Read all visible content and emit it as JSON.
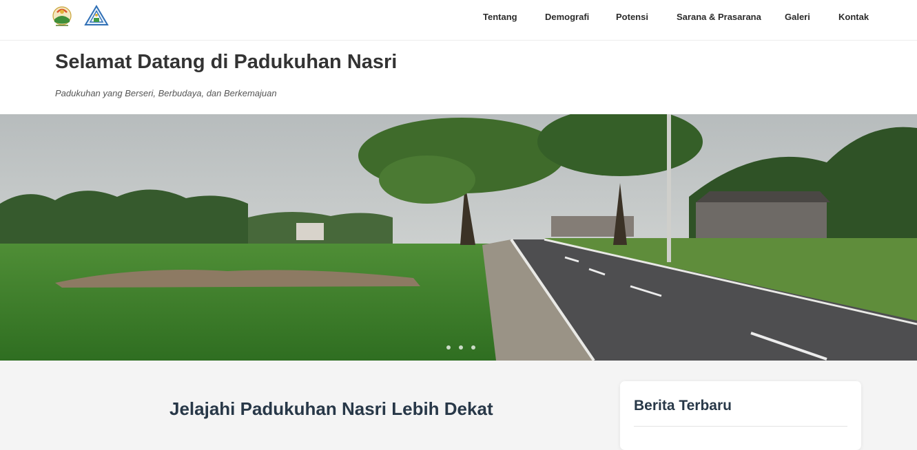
{
  "nav": {
    "items": [
      {
        "label": "Tentang"
      },
      {
        "label": "Demografi"
      },
      {
        "label": "Potensi"
      },
      {
        "label": "Sarana & Prasarana"
      },
      {
        "label": "Galeri"
      },
      {
        "label": "Kontak"
      }
    ],
    "logos": [
      "village-emblem-icon",
      "triangle-emblem-icon"
    ]
  },
  "header": {
    "title": "Selamat Datang di Padukuhan Nasri",
    "tagline": "Padukuhan yang Berseri, Berbudaya, dan Berkemajuan"
  },
  "hero": {
    "scene": "rural road between rice field and houses",
    "slides": 3,
    "active_slide": 1
  },
  "main": {
    "section_title": "Jelajahi Padukuhan Nasri Lebih Dekat"
  },
  "sidebar": {
    "news_title": "Berita Terbaru"
  },
  "colors": {
    "heading": "#283848",
    "nav_text": "#2b2b2b",
    "background": "#f4f4f4"
  }
}
